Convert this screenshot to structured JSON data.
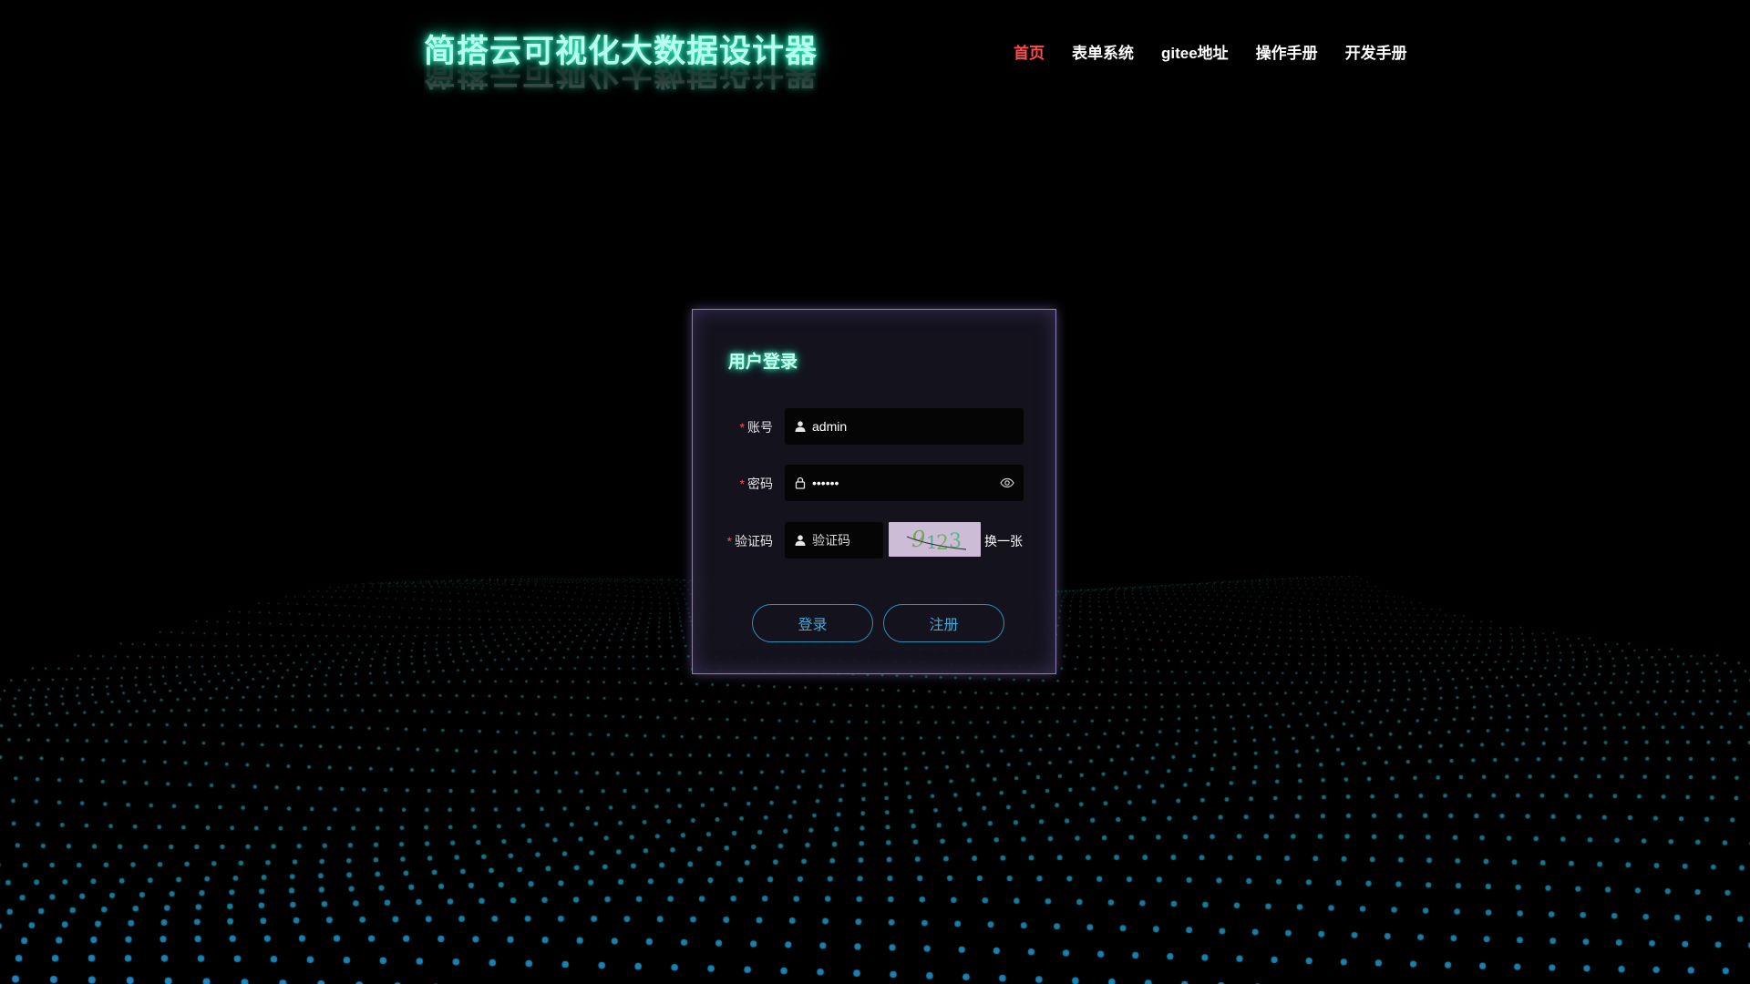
{
  "header": {
    "logo_text": "简搭云可视化大数据设计器",
    "nav": [
      {
        "label": "首页",
        "active": true
      },
      {
        "label": "表单系统",
        "active": false
      },
      {
        "label": "gitee地址",
        "active": false
      },
      {
        "label": "操作手册",
        "active": false
      },
      {
        "label": "开发手册",
        "active": false
      }
    ]
  },
  "login": {
    "title": "用户登录",
    "required_mark": "*",
    "account": {
      "label": "账号",
      "value": "admin",
      "icon": "user-icon"
    },
    "password": {
      "label": "密码",
      "value": "••••••",
      "icon": "lock-icon",
      "toggle_icon": "eye-icon"
    },
    "captcha": {
      "label": "验证码",
      "placeholder": "验证码",
      "icon": "user-icon",
      "image_text": "9123",
      "refresh_label": "换一张"
    },
    "login_button": "登录",
    "register_button": "注册"
  },
  "colors": {
    "background": "#000000",
    "accent_glow": "#16c79a",
    "nav_active": "#ff4d4d",
    "button_border": "#2f8fb5",
    "dots": "#1e8fb5"
  }
}
